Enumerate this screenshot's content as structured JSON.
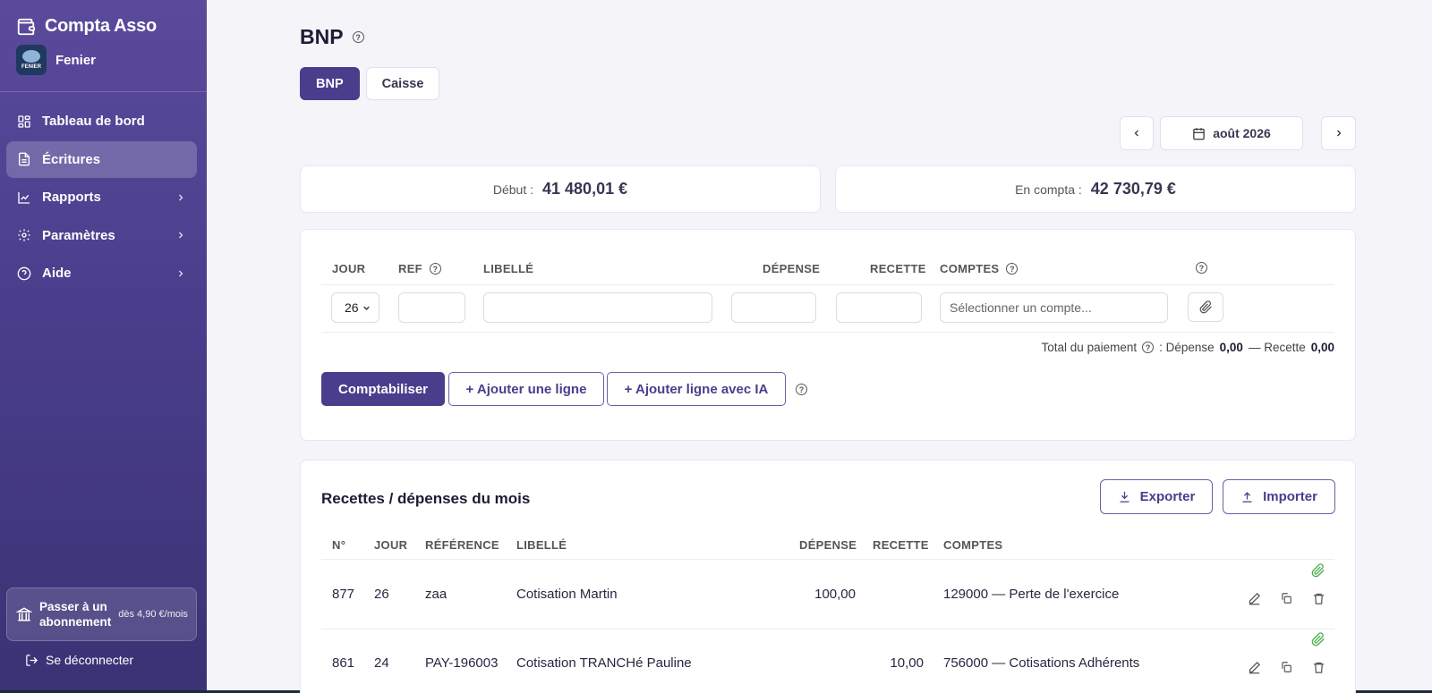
{
  "app": {
    "title": "Compta Asso",
    "org_name": "Fenier",
    "org_logo_text": "FENIER"
  },
  "sidebar": {
    "items": [
      {
        "label": "Tableau de bord",
        "icon": "dashboard-icon"
      },
      {
        "label": "Écritures",
        "icon": "document-icon",
        "active": true
      },
      {
        "label": "Rapports",
        "icon": "chart-line-icon"
      },
      {
        "label": "Paramètres",
        "icon": "gear-icon"
      },
      {
        "label": "Aide",
        "icon": "help-circle-icon"
      }
    ],
    "upgrade": {
      "label": "Passer à un abonnement",
      "price": "dès 4,90 €/mois"
    },
    "logout": "Se déconnecter"
  },
  "page": {
    "title": "BNP"
  },
  "account_tabs": [
    {
      "label": "BNP",
      "active": true
    },
    {
      "label": "Caisse"
    }
  ],
  "period": {
    "month": "août 2026"
  },
  "balances": {
    "debut_label": "Début :",
    "debut_value": "41 480,01 €",
    "compta_label": "En compta :",
    "compta_value": "42 730,79 €"
  },
  "entry_form": {
    "headers": {
      "jour": "JOUR",
      "ref": "REF",
      "libelle": "LIBELLÉ",
      "depense": "DÉPENSE",
      "recette": "RECETTE",
      "comptes": "COMPTES"
    },
    "day_value": "26",
    "account_placeholder": "Sélectionner un compte...",
    "total": {
      "label": "Total du paiement",
      "depense_label": ": Dépense",
      "depense": "0,00",
      "recette_label": "— Recette",
      "recette": "0,00"
    },
    "buttons": {
      "submit": "Comptabiliser",
      "add_line": "+ Ajouter une ligne",
      "add_ai": "+ Ajouter ligne avec IA"
    }
  },
  "list": {
    "title": "Recettes / dépenses du mois",
    "export": "Exporter",
    "import": "Importer",
    "headers": {
      "num": "N°",
      "jour": "JOUR",
      "reference": "RÉFÉRENCE",
      "libelle": "LIBELLÉ",
      "depense": "DÉPENSE",
      "recette": "RECETTE",
      "comptes": "COMPTES"
    },
    "rows": [
      {
        "num": "877",
        "jour": "26",
        "reference": "zaa",
        "libelle": "Cotisation Martin",
        "depense": "100,00",
        "recette": "",
        "compte": "129000 — Perte de l'exercice"
      },
      {
        "num": "861",
        "jour": "24",
        "reference": "PAY-196003",
        "libelle": "Cotisation TRANCHé Pauline",
        "depense": "",
        "recette": "10,00",
        "compte": "756000 — Cotisations Adhérents"
      }
    ]
  },
  "colors": {
    "primary": "#4a3e8c",
    "sidebar_top": "#5a4a9c",
    "sidebar_bottom": "#3a3274",
    "attachment": "#4caf50"
  }
}
